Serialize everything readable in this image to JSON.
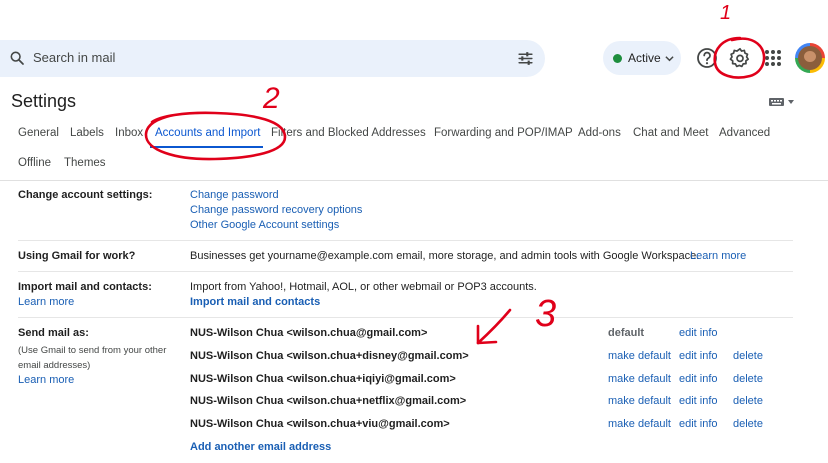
{
  "search": {
    "placeholder": "Search in mail"
  },
  "status": {
    "label": "Active",
    "color": "#1e8e3e"
  },
  "icons": {
    "help": "help-icon",
    "settings": "gear-icon",
    "apps": "apps-grid-icon",
    "keyboard": "keyboard-icon"
  },
  "page_title": "Settings",
  "tabs": [
    {
      "label": "General"
    },
    {
      "label": "Labels"
    },
    {
      "label": "Inbox"
    },
    {
      "label": "Accounts and Import"
    },
    {
      "label": "Filters and Blocked Addresses"
    },
    {
      "label": "Forwarding and POP/IMAP"
    },
    {
      "label": "Add-ons"
    },
    {
      "label": "Chat and Meet"
    },
    {
      "label": "Advanced"
    },
    {
      "label": "Offline"
    },
    {
      "label": "Themes"
    }
  ],
  "change_account": {
    "label": "Change account settings:",
    "links": [
      "Change password",
      "Change password recovery options",
      "Other Google Account settings"
    ]
  },
  "gmail_work": {
    "label": "Using Gmail for work?",
    "text": "Businesses get yourname@example.com email, more storage, and admin tools with Google Workspace.",
    "link": "Learn more"
  },
  "import": {
    "label": "Import mail and contacts:",
    "learn_more": "Learn more",
    "text": "Import from Yahoo!, Hotmail, AOL, or other webmail or POP3 accounts.",
    "action": "Import mail and contacts"
  },
  "send_as": {
    "label": "Send mail as:",
    "note": "(Use Gmail to send from your other email addresses)",
    "learn_more": "Learn more",
    "rows": [
      {
        "address": "NUS-Wilson Chua <wilson.chua@gmail.com>",
        "status": "default",
        "edit": "edit info"
      },
      {
        "address": "NUS-Wilson Chua <wilson.chua+disney@gmail.com>",
        "make_default": "make default",
        "edit": "edit info",
        "delete": "delete"
      },
      {
        "address": "NUS-Wilson Chua <wilson.chua+iqiyi@gmail.com>",
        "make_default": "make default",
        "edit": "edit info",
        "delete": "delete"
      },
      {
        "address": "NUS-Wilson Chua <wilson.chua+netflix@gmail.com>",
        "make_default": "make default",
        "edit": "edit info",
        "delete": "delete"
      },
      {
        "address": "NUS-Wilson Chua <wilson.chua+viu@gmail.com>",
        "make_default": "make default",
        "edit": "edit info",
        "delete": "delete"
      }
    ],
    "add_link": "Add another email address"
  },
  "annotations": {
    "one": "1",
    "two": "2",
    "three": "3",
    "color": "#e0001a"
  }
}
